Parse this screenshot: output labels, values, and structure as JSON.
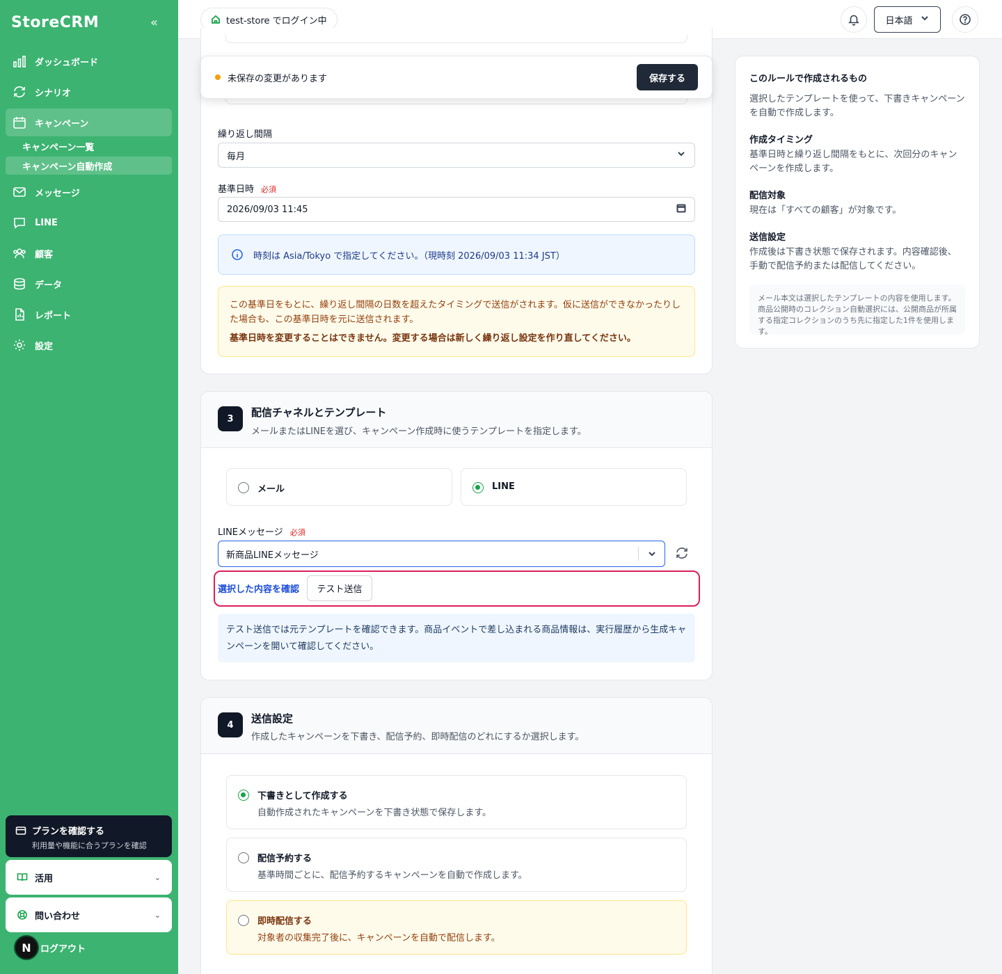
{
  "brand": "StoreCRM",
  "sidebar": {
    "items": [
      {
        "label": "ダッシュボード"
      },
      {
        "label": "シナリオ"
      },
      {
        "label": "キャンペーン"
      },
      {
        "label": "メッセージ"
      },
      {
        "label": "LINE"
      },
      {
        "label": "顧客"
      },
      {
        "label": "データ"
      },
      {
        "label": "レポート"
      },
      {
        "label": "設定"
      }
    ],
    "sub_items": [
      {
        "label": "キャンペーン一覧"
      },
      {
        "label": "キャンペーン自動作成"
      }
    ],
    "plan": {
      "title": "プランを確認する",
      "subtitle": "利用量や機能に合うプランを確認"
    },
    "accordions": [
      {
        "label": "活用"
      },
      {
        "label": "問い合わせ"
      }
    ],
    "logout": "ログアウト",
    "avatar_letter": "N"
  },
  "topbar": {
    "store_status": "test-store でログイン中",
    "language": "日本語"
  },
  "unsaved": {
    "message": "未保存の変更があります",
    "save_label": "保存する"
  },
  "schedule": {
    "interval_label": "繰り返し間隔",
    "interval_value": "毎月",
    "base_label": "基準日時",
    "required": "必須",
    "base_value": "2026/09/03 11:45",
    "timezone_info": "時刻は Asia/Tokyo で指定してください。（現時刻 2026/09/03 11:34 JST）",
    "warning_text": "この基準日をもとに、繰り返し間隔の日数を超えたタイミングで送信がされます。仮に送信ができなかったりした場合も、この基準日時を元に送信されます。",
    "warning_bold": "基準日時を変更することはできません。変更する場合は新しく繰り返し設定を作り直してください。"
  },
  "section3": {
    "number": "3",
    "title": "配信チャネルとテンプレート",
    "desc": "メールまたはLINEを選び、キャンペーン作成時に使うテンプレートを指定します。",
    "channel_mail": "メール",
    "channel_line": "LINE",
    "line_label": "LINEメッセージ",
    "required": "必須",
    "line_value": "新商品LINEメッセージ",
    "confirm_link": "選択した内容を確認",
    "test_send": "テスト送信",
    "note": "テスト送信では元テンプレートを確認できます。商品イベントで差し込まれる商品情報は、実行履歴から生成キャンペーンを開いて確認してください。"
  },
  "section4": {
    "number": "4",
    "title": "送信設定",
    "desc": "作成したキャンペーンを下書き、配信予約、即時配信のどれにするか選択します。",
    "options": [
      {
        "title": "下書きとして作成する",
        "desc": "自動作成されたキャンペーンを下書き状態で保存します。"
      },
      {
        "title": "配信予約する",
        "desc": "基準時間ごとに、配信予約するキャンペーンを自動で作成します。"
      },
      {
        "title": "即時配信する",
        "desc": "対象者の収集完了後に、キャンペーンを自動で配信します。"
      }
    ]
  },
  "right_panel": {
    "heading": "このルールで作成されるもの",
    "intro": "選択したテンプレートを使って、下書きキャンペーンを自動で作成します。",
    "timing_title": "作成タイミング",
    "timing_text": "基準日時と繰り返し間隔をもとに、次回分のキャンペーンを作成します。",
    "target_title": "配信対象",
    "target_text": "現在は「すべての顧客」が対象です。",
    "send_title": "送信設定",
    "send_text": "作成後は下書き状態で保存されます。内容確認後、手動で配信予約または配信してください。",
    "note": "メール本文は選択したテンプレートの内容を使用します。商品公開時のコレクション自動選択には、公開商品が所属する指定コレクションのうち先に指定した1件を使用します。"
  },
  "colors": {
    "sidebar": "#3cb371",
    "dark": "#111827",
    "accent_blue": "#2563eb",
    "highlight": "#dc1f5a",
    "radio_on": "#16a34a"
  }
}
